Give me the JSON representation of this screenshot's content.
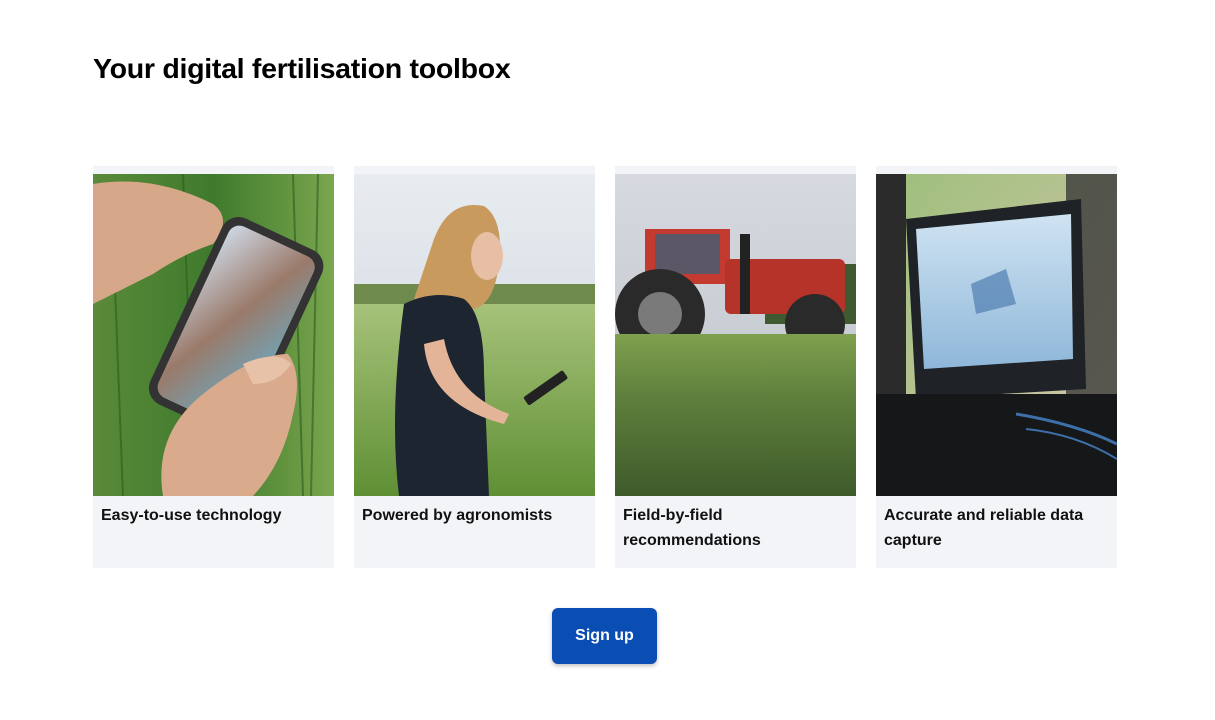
{
  "section": {
    "title": "Your digital fertilisation toolbox"
  },
  "cards": [
    {
      "caption": "Easy-to-use technology",
      "image": "hands-holding-smartphone-in-field"
    },
    {
      "caption": "Powered by agronomists",
      "image": "woman-with-tablet-in-field"
    },
    {
      "caption": "Field-by-field recommendations",
      "image": "red-tractor-in-crop-field"
    },
    {
      "caption": "Accurate and reliable data capture",
      "image": "tractor-cab-terminal-screen"
    }
  ],
  "cta": {
    "signup_label": "Sign up"
  },
  "colors": {
    "card_background": "#f2f4f7",
    "button_background": "#0a4db3",
    "button_text": "#ffffff"
  }
}
